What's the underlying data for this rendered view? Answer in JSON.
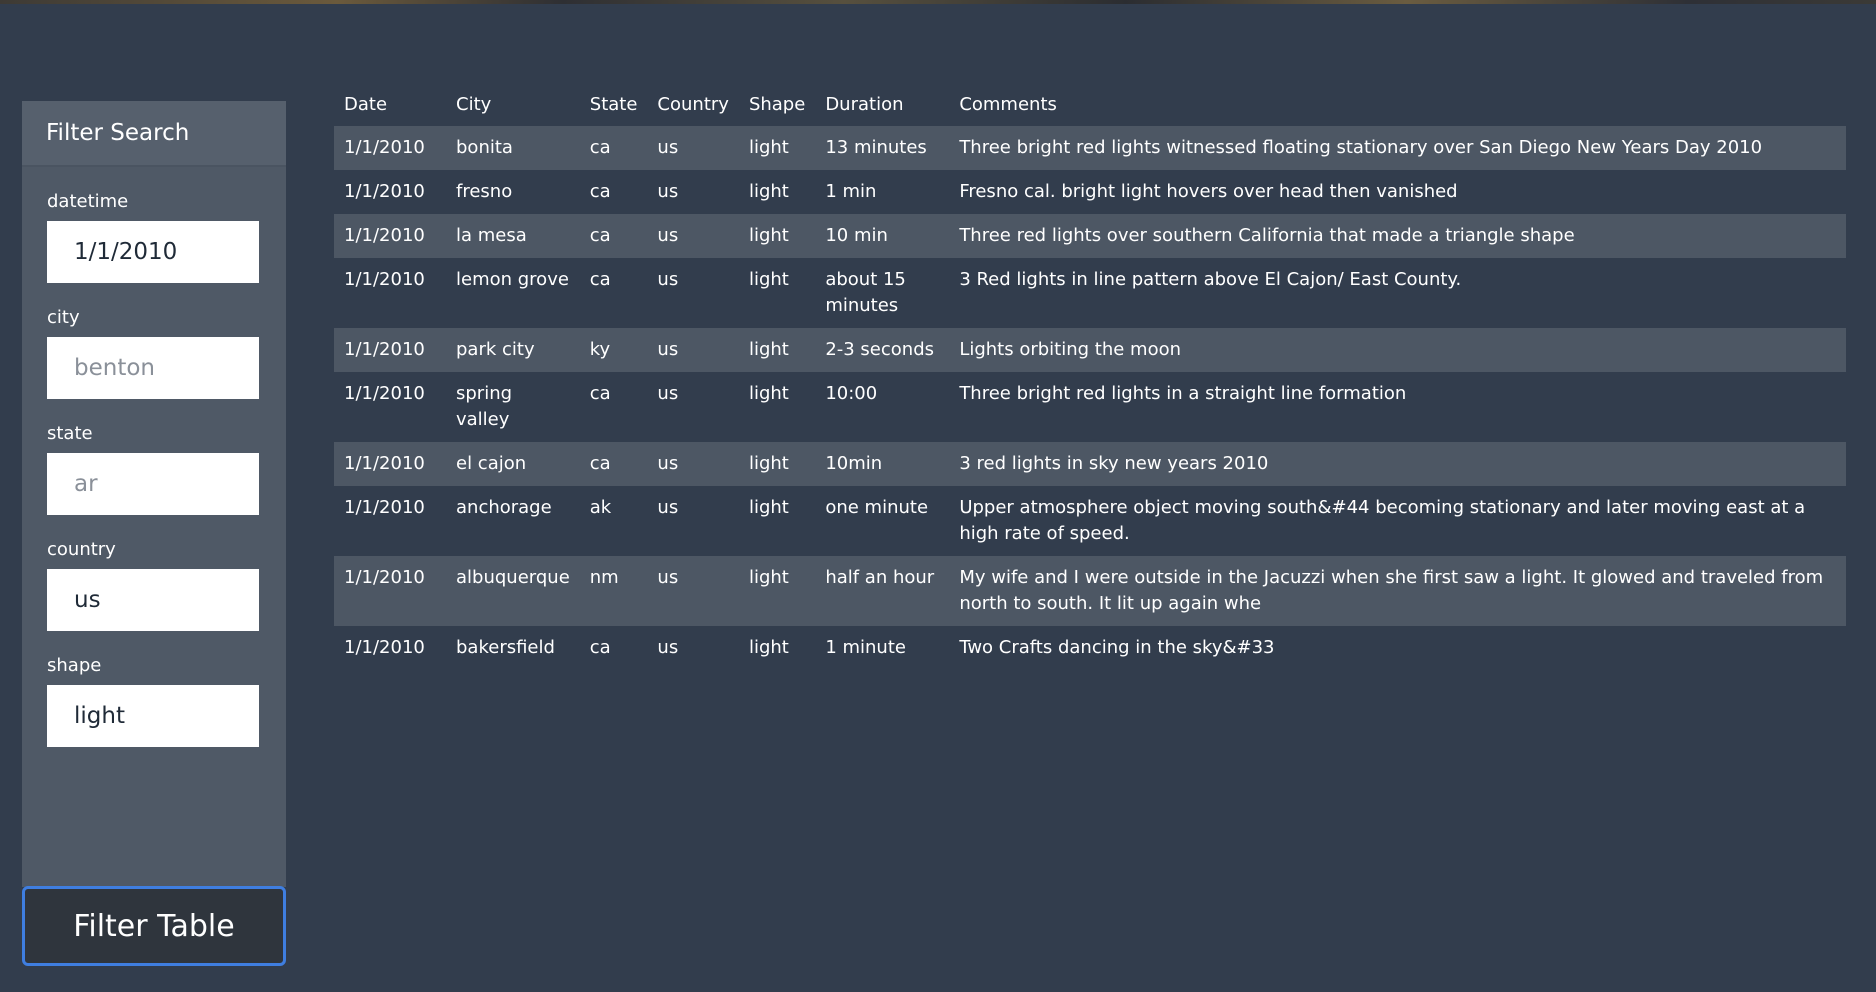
{
  "sidebar": {
    "title": "Filter Search",
    "fields": [
      {
        "label": "datetime",
        "value": "1/1/2010",
        "placeholder": ""
      },
      {
        "label": "city",
        "value": "",
        "placeholder": "benton"
      },
      {
        "label": "state",
        "value": "",
        "placeholder": "ar"
      },
      {
        "label": "country",
        "value": "us",
        "placeholder": ""
      },
      {
        "label": "shape",
        "value": "light",
        "placeholder": ""
      }
    ],
    "button_label": "Filter Table"
  },
  "table": {
    "headers": [
      "Date",
      "City",
      "State",
      "Country",
      "Shape",
      "Duration",
      "Comments"
    ],
    "rows": [
      [
        "1/1/2010",
        "bonita",
        "ca",
        "us",
        "light",
        "13 minutes",
        "Three bright red lights witnessed floating stationary over San Diego New Years Day 2010"
      ],
      [
        "1/1/2010",
        "fresno",
        "ca",
        "us",
        "light",
        "1 min",
        "Fresno cal. bright light hovers over head then vanished"
      ],
      [
        "1/1/2010",
        "la mesa",
        "ca",
        "us",
        "light",
        "10 min",
        "Three red lights over southern California that made a triangle shape"
      ],
      [
        "1/1/2010",
        "lemon grove",
        "ca",
        "us",
        "light",
        "about 15 minutes",
        "3 Red lights in line pattern above El Cajon/ East County."
      ],
      [
        "1/1/2010",
        "park city",
        "ky",
        "us",
        "light",
        "2-3 seconds",
        "Lights orbiting the moon"
      ],
      [
        "1/1/2010",
        "spring valley",
        "ca",
        "us",
        "light",
        "10:00",
        "Three bright red lights in a straight line formation"
      ],
      [
        "1/1/2010",
        "el cajon",
        "ca",
        "us",
        "light",
        "10min",
        "3 red lights in sky new years 2010"
      ],
      [
        "1/1/2010",
        "anchorage",
        "ak",
        "us",
        "light",
        "one minute",
        "Upper atmosphere object moving south&#44 becoming stationary and later moving east at a high rate of speed."
      ],
      [
        "1/1/2010",
        "albuquerque",
        "nm",
        "us",
        "light",
        "half an hour",
        "My wife and I were outside in the Jacuzzi when she first saw a light. It glowed and traveled from north to south. It lit up again whe"
      ],
      [
        "1/1/2010",
        "bakersfield",
        "ca",
        "us",
        "light",
        "1 minute",
        "Two Crafts dancing in the sky&#33"
      ]
    ]
  }
}
